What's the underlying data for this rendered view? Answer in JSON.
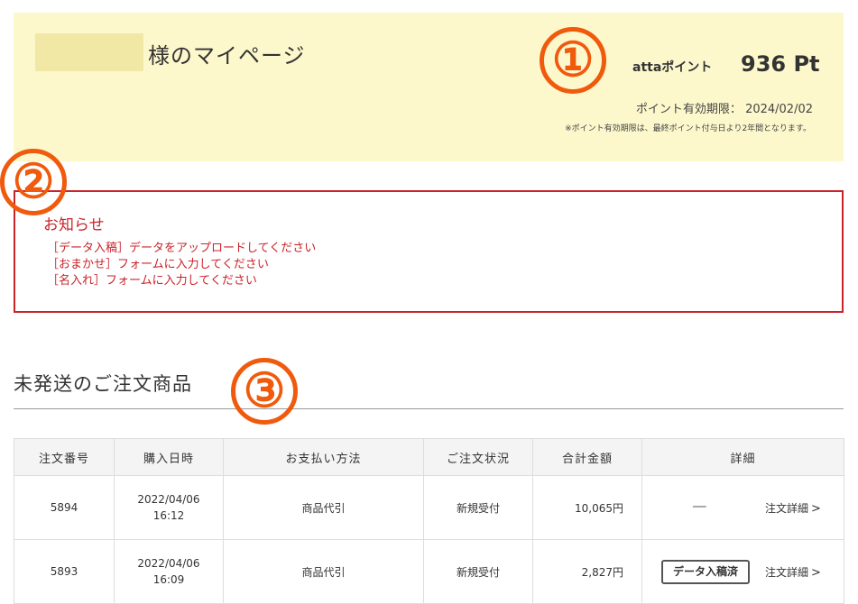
{
  "header": {
    "title": "様のマイページ",
    "points_label": "attaポイント",
    "points_value": "936 Pt",
    "expiry_label": "ポイント有効期限：",
    "expiry_date": "2024/02/02",
    "expiry_note": "※ポイント有効期限は、最終ポイント付与日より2年間となります。"
  },
  "markers": [
    "①",
    "②",
    "③"
  ],
  "notice": {
    "title": "お知らせ",
    "items": [
      "［データ入稿］データをアップロードしてください",
      "［おまかせ］フォームに入力してください",
      "［名入れ］フォームに入力してください"
    ]
  },
  "orders": {
    "heading": "未発送のご注文商品",
    "columns": [
      "注文番号",
      "購入日時",
      "お支払い方法",
      "ご注文状況",
      "合計金額",
      "詳細"
    ],
    "rows": [
      {
        "order_no": "5894",
        "date": "2022/04/06",
        "time": "16:12",
        "payment": "商品代引",
        "status": "新規受付",
        "amount": "10,065円",
        "badge": "──",
        "detail": "注文詳細"
      },
      {
        "order_no": "5893",
        "date": "2022/04/06",
        "time": "16:09",
        "payment": "商品代引",
        "status": "新規受付",
        "amount": "2,827円",
        "badge": "データ入稿済",
        "detail": "注文詳細"
      }
    ]
  },
  "colors": {
    "header_bg": "#fdf8cc",
    "notice_red": "#c9232a",
    "marker_orange": "#f05a0d"
  },
  "icons": {
    "detail_link": "chevron-right-icon"
  }
}
